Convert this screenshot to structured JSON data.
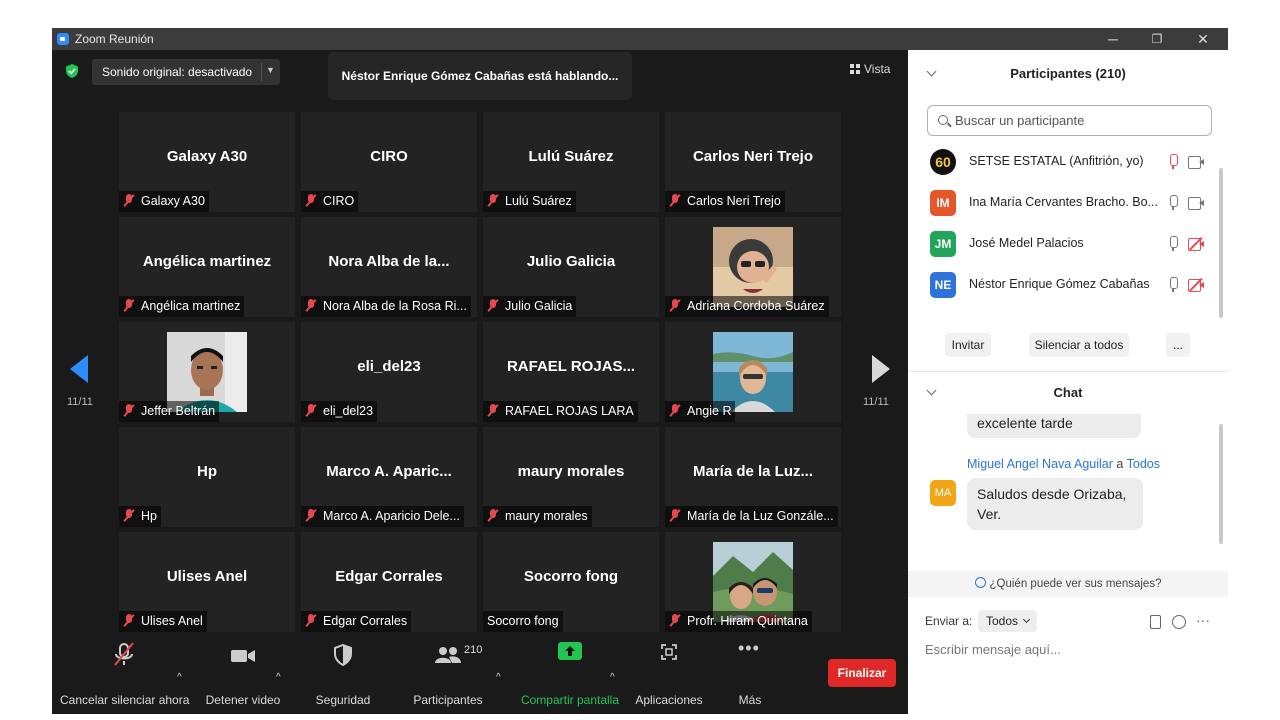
{
  "window": {
    "title": "Zoom Reunión",
    "controls": {
      "minimize": "─",
      "restore": "❐",
      "close": "✕"
    }
  },
  "top_bar": {
    "sound_label": "Sonido original: desactivado",
    "speaking_banner": "Néstor Enrique Gómez Cabañas está hablando...",
    "view_label": "Vista"
  },
  "paging": {
    "left": "11/11",
    "right": "11/11"
  },
  "tiles": [
    {
      "big": "Galaxy A30",
      "caption": "Galaxy A30",
      "muted": true
    },
    {
      "big": "CIRO",
      "caption": "CIRO",
      "muted": true
    },
    {
      "big": "Lulú Suárez",
      "caption": "Lulú Suárez",
      "muted": true
    },
    {
      "big": "Carlos Neri Trejo",
      "caption": "Carlos Neri Trejo",
      "muted": true
    },
    {
      "big": "Angélica martinez",
      "caption": "Angélica martinez",
      "muted": true
    },
    {
      "big": "Nora Alba de la...",
      "caption": "Nora Alba de la Rosa Ri...",
      "muted": true
    },
    {
      "big": "Julio Galicia",
      "caption": "Julio Galicia",
      "muted": true
    },
    {
      "big": "",
      "caption": "Adriana Cordoba Suárez",
      "muted": true,
      "photo": "woman-peace-sign"
    },
    {
      "big": "",
      "caption": "Jeffer Beltrán",
      "muted": true,
      "photo": "man-portrait"
    },
    {
      "big": "eli_del23",
      "caption": "eli_del23",
      "muted": true
    },
    {
      "big": "RAFAEL ROJAS...",
      "caption": "RAFAEL ROJAS LARA",
      "muted": true
    },
    {
      "big": "",
      "caption": "Angie R",
      "muted": true,
      "photo": "woman-sea"
    },
    {
      "big": "Hp",
      "caption": "Hp",
      "muted": true
    },
    {
      "big": "Marco A. Aparic...",
      "caption": "Marco A. Aparicio Dele...",
      "muted": true
    },
    {
      "big": "maury morales",
      "caption": "maury morales",
      "muted": true
    },
    {
      "big": "María de la Luz...",
      "caption": "María de la Luz Gonzále...",
      "muted": true
    },
    {
      "big": "Ulises Anel",
      "caption": "Ulises Anel",
      "muted": true
    },
    {
      "big": "Edgar Corrales",
      "caption": "Edgar Corrales",
      "muted": true
    },
    {
      "big": "Socorro fong",
      "caption": "Socorro fong",
      "muted": false
    },
    {
      "big": "",
      "caption": "Profr. Hiram Quintana",
      "muted": true,
      "photo": "couple-mountains"
    }
  ],
  "toolbar": {
    "unmute": "Cancelar silenciar ahora",
    "stop_video": "Detener video",
    "security": "Seguridad",
    "participants": "Participantes",
    "participants_count": "210",
    "share": "Compartir pantalla",
    "apps": "Aplicaciones",
    "more": "Más",
    "end": "Finalizar"
  },
  "participants_panel": {
    "title": "Participantes (210)",
    "search_placeholder": "Buscar un participante",
    "items": [
      {
        "initials": "60",
        "name": "SETSE ESTATAL (Anfitrión, yo)",
        "color": "#111111",
        "mic_off": true,
        "cam_off": false
      },
      {
        "initials": "IM",
        "name": "Ina María Cervantes Bracho. Bo...",
        "color": "#e5562a",
        "mic_off": false,
        "cam_off": false
      },
      {
        "initials": "JM",
        "name": "José Medel Palacios",
        "color": "#22a559",
        "mic_off": false,
        "cam_off": true
      },
      {
        "initials": "NE",
        "name": "Néstor Enrique Gómez Cabañas",
        "color": "#2d73d9",
        "mic_off": false,
        "cam_off": true
      }
    ],
    "invite": "Invitar",
    "mute_all": "Silenciar a todos",
    "more": "..."
  },
  "chat": {
    "title": "Chat",
    "prev_message": "excelente tarde",
    "sender": "Miguel Angel Nava Aguilar",
    "to_word": "a",
    "recipient": "Todos",
    "sender_initials": "MA",
    "message_line1": "Saludos desde Orizaba,",
    "message_line2": "Ver.",
    "who_can_see": "¿Quién puede ver sus mensajes?",
    "send_to_label": "Enviar a:",
    "send_to_value": "Todos",
    "compose_placeholder": "Escribir mensaje aquí..."
  }
}
